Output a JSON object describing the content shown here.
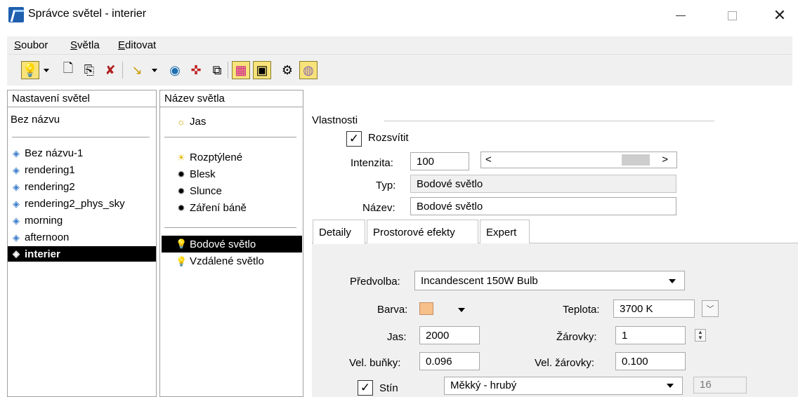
{
  "window": {
    "title": "Správce světel - interier",
    "minimize": "—",
    "maximize": "☐",
    "close": "✕"
  },
  "menu": {
    "items": [
      {
        "label": "Soubor",
        "mnemonic": "S"
      },
      {
        "label": "Světla",
        "mnemonic": "S"
      },
      {
        "label": "Editovat",
        "mnemonic": "E"
      }
    ]
  },
  "toolbar": {
    "buttons": [
      {
        "name": "light-bulb-icon",
        "glyph": "💡",
        "toggled": true
      },
      {
        "name": "new-icon",
        "glyph": "🗋",
        "toggled": false
      },
      {
        "name": "copy-icon",
        "glyph": "⎘",
        "toggled": false
      },
      {
        "name": "delete-icon",
        "glyph": "✘",
        "toggled": false
      },
      {
        "name": "spot-light-icon",
        "glyph": "↘",
        "toggled": false
      },
      {
        "name": "globe-icon",
        "glyph": "◉",
        "toggled": false
      },
      {
        "name": "compass-icon",
        "glyph": "✜",
        "toggled": false
      },
      {
        "name": "window-icon",
        "glyph": "⧉",
        "toggled": false
      },
      {
        "name": "grid-view-icon",
        "glyph": "▦",
        "toggled": true
      },
      {
        "name": "light-view-icon",
        "glyph": "▣",
        "toggled": true
      },
      {
        "name": "settings-icon",
        "glyph": "⚙",
        "toggled": false
      },
      {
        "name": "sky-icon",
        "glyph": "◍",
        "toggled": true
      }
    ]
  },
  "left_pane": {
    "header": "Nastavení světel",
    "top_item": "Bez názvu",
    "items": [
      {
        "label": "Bez názvu-1",
        "selected": false
      },
      {
        "label": "rendering1",
        "selected": false
      },
      {
        "label": "rendering2",
        "selected": false
      },
      {
        "label": "rendering2_phys_sky",
        "selected": false
      },
      {
        "label": "morning",
        "selected": false
      },
      {
        "label": "afternoon",
        "selected": false
      },
      {
        "label": "interier",
        "selected": true
      }
    ]
  },
  "middle_pane": {
    "header": "Název světla",
    "group1": [
      {
        "label": "Jas",
        "icon": "☼"
      }
    ],
    "group2": [
      {
        "label": "Rozptýlené",
        "icon": "☀"
      },
      {
        "label": "Blesk",
        "icon": "✹"
      },
      {
        "label": "Slunce",
        "icon": "✹"
      },
      {
        "label": "Záření báně",
        "icon": "✹"
      }
    ],
    "group3": [
      {
        "label": "Bodové světlo",
        "icon": "💡",
        "selected": true
      },
      {
        "label": "Vzdálené světlo",
        "icon": "💡",
        "selected": false
      }
    ]
  },
  "properties": {
    "section_label": "Vlastnosti",
    "enable_label": "Rozsvítit",
    "enable_checked": "✓",
    "intensity_label": "Intenzita:",
    "intensity_value": "100",
    "scroll_left": "<",
    "scroll_right": ">",
    "type_label": "Typ:",
    "type_value": "Bodové světlo",
    "name_label": "Název:",
    "name_value": "Bodové světlo"
  },
  "tabs": [
    {
      "label": "Detaily",
      "active": true
    },
    {
      "label": "Prostorové efekty",
      "active": false
    },
    {
      "label": "Expert",
      "active": false
    }
  ],
  "details": {
    "preset_label": "Předvolba:",
    "preset_value": "Incandescent 150W Bulb",
    "color_label": "Barva:",
    "color_hex": "#f7c08b",
    "temperature_label": "Teplota:",
    "temperature_value": "3700 K",
    "brightness_label": "Jas:",
    "brightness_value": "2000",
    "bulbs_label": "Žárovky:",
    "bulbs_value": "1",
    "cell_size_label": "Vel. buňky:",
    "cell_size_value": "0.096",
    "bulb_size_label": "Vel. žárovky:",
    "bulb_size_value": "0.100",
    "shadow_label": "Stín",
    "shadow_checked": "✓",
    "shadow_mode_value": "Měkký - hrubý",
    "shadow_samples_value": "16"
  }
}
